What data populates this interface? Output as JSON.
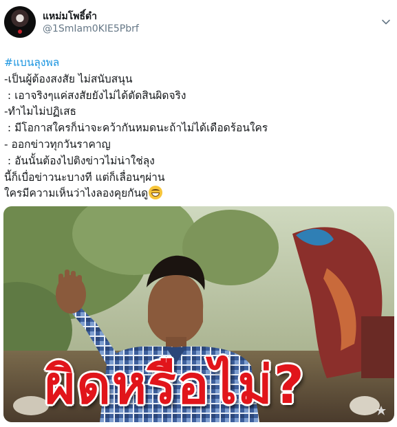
{
  "user": {
    "display_name": "แหม่มโพธิ์ดำ",
    "handle": "@1SmIam0KIE5Pbrf",
    "avatar_icon": "profile-avatar"
  },
  "menu": {
    "icon": "chevron-down-icon"
  },
  "tweet": {
    "hashtag": "#แบนลุงพล",
    "lines": [
      "-เป็นผู้ต้องสงสัย ไม่สนับสนุน",
      " : เอาจริงๆแค่สงสัยยังไม่ได้ตัดสินผิดจริง",
      "-ทำไมไม่ปฏิเสธ",
      " : มีโอกาสใครก็น่าจะคว้ากันหมดนะถ้าไม่ได้เดือดร้อนใคร",
      "- ออกข่าวทุกวันราคาญ",
      " : อันนั้นต้องไปติงข่าวไม่น่าใช่ลุง",
      "นี้ก็เบื่อข่าวนะบางที แต่ก็เลื่อนๆผ่าน"
    ],
    "last_line": "ใครมีความเห็นว่าไงลองคุยกันดู",
    "emoji": "grinning-face-emoji"
  },
  "media": {
    "overlay_text": "ผิดหรือไม่?",
    "accent_color": "#e1151b",
    "watermark_icon": "watermark-icon"
  },
  "colors": {
    "hashtag": "#1b95e0",
    "handle": "#657786",
    "text": "#14171a"
  }
}
